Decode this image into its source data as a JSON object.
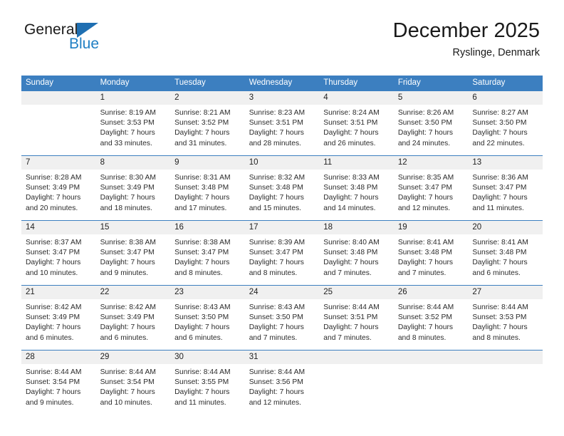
{
  "brand": {
    "name_top": "General",
    "name_bottom": "Blue",
    "triangle_color": "#1f6fb2",
    "blue_text_color": "#1f7fc4"
  },
  "header": {
    "title": "December 2025",
    "subtitle": "Ryslinge, Denmark"
  },
  "theme": {
    "header_row_bg": "#3c7fc0",
    "header_row_text": "#ffffff",
    "daynum_bg": "#f0f0f0",
    "row_separator": "#3c7fc0"
  },
  "calendar": {
    "weekday_headers": [
      "Sunday",
      "Monday",
      "Tuesday",
      "Wednesday",
      "Thursday",
      "Friday",
      "Saturday"
    ],
    "weeks": [
      [
        {
          "day": "",
          "lines": []
        },
        {
          "day": "1",
          "lines": [
            "Sunrise: 8:19 AM",
            "Sunset: 3:53 PM",
            "Daylight: 7 hours",
            "and 33 minutes."
          ]
        },
        {
          "day": "2",
          "lines": [
            "Sunrise: 8:21 AM",
            "Sunset: 3:52 PM",
            "Daylight: 7 hours",
            "and 31 minutes."
          ]
        },
        {
          "day": "3",
          "lines": [
            "Sunrise: 8:23 AM",
            "Sunset: 3:51 PM",
            "Daylight: 7 hours",
            "and 28 minutes."
          ]
        },
        {
          "day": "4",
          "lines": [
            "Sunrise: 8:24 AM",
            "Sunset: 3:51 PM",
            "Daylight: 7 hours",
            "and 26 minutes."
          ]
        },
        {
          "day": "5",
          "lines": [
            "Sunrise: 8:26 AM",
            "Sunset: 3:50 PM",
            "Daylight: 7 hours",
            "and 24 minutes."
          ]
        },
        {
          "day": "6",
          "lines": [
            "Sunrise: 8:27 AM",
            "Sunset: 3:50 PM",
            "Daylight: 7 hours",
            "and 22 minutes."
          ]
        }
      ],
      [
        {
          "day": "7",
          "lines": [
            "Sunrise: 8:28 AM",
            "Sunset: 3:49 PM",
            "Daylight: 7 hours",
            "and 20 minutes."
          ]
        },
        {
          "day": "8",
          "lines": [
            "Sunrise: 8:30 AM",
            "Sunset: 3:49 PM",
            "Daylight: 7 hours",
            "and 18 minutes."
          ]
        },
        {
          "day": "9",
          "lines": [
            "Sunrise: 8:31 AM",
            "Sunset: 3:48 PM",
            "Daylight: 7 hours",
            "and 17 minutes."
          ]
        },
        {
          "day": "10",
          "lines": [
            "Sunrise: 8:32 AM",
            "Sunset: 3:48 PM",
            "Daylight: 7 hours",
            "and 15 minutes."
          ]
        },
        {
          "day": "11",
          "lines": [
            "Sunrise: 8:33 AM",
            "Sunset: 3:48 PM",
            "Daylight: 7 hours",
            "and 14 minutes."
          ]
        },
        {
          "day": "12",
          "lines": [
            "Sunrise: 8:35 AM",
            "Sunset: 3:47 PM",
            "Daylight: 7 hours",
            "and 12 minutes."
          ]
        },
        {
          "day": "13",
          "lines": [
            "Sunrise: 8:36 AM",
            "Sunset: 3:47 PM",
            "Daylight: 7 hours",
            "and 11 minutes."
          ]
        }
      ],
      [
        {
          "day": "14",
          "lines": [
            "Sunrise: 8:37 AM",
            "Sunset: 3:47 PM",
            "Daylight: 7 hours",
            "and 10 minutes."
          ]
        },
        {
          "day": "15",
          "lines": [
            "Sunrise: 8:38 AM",
            "Sunset: 3:47 PM",
            "Daylight: 7 hours",
            "and 9 minutes."
          ]
        },
        {
          "day": "16",
          "lines": [
            "Sunrise: 8:38 AM",
            "Sunset: 3:47 PM",
            "Daylight: 7 hours",
            "and 8 minutes."
          ]
        },
        {
          "day": "17",
          "lines": [
            "Sunrise: 8:39 AM",
            "Sunset: 3:47 PM",
            "Daylight: 7 hours",
            "and 8 minutes."
          ]
        },
        {
          "day": "18",
          "lines": [
            "Sunrise: 8:40 AM",
            "Sunset: 3:48 PM",
            "Daylight: 7 hours",
            "and 7 minutes."
          ]
        },
        {
          "day": "19",
          "lines": [
            "Sunrise: 8:41 AM",
            "Sunset: 3:48 PM",
            "Daylight: 7 hours",
            "and 7 minutes."
          ]
        },
        {
          "day": "20",
          "lines": [
            "Sunrise: 8:41 AM",
            "Sunset: 3:48 PM",
            "Daylight: 7 hours",
            "and 6 minutes."
          ]
        }
      ],
      [
        {
          "day": "21",
          "lines": [
            "Sunrise: 8:42 AM",
            "Sunset: 3:49 PM",
            "Daylight: 7 hours",
            "and 6 minutes."
          ]
        },
        {
          "day": "22",
          "lines": [
            "Sunrise: 8:42 AM",
            "Sunset: 3:49 PM",
            "Daylight: 7 hours",
            "and 6 minutes."
          ]
        },
        {
          "day": "23",
          "lines": [
            "Sunrise: 8:43 AM",
            "Sunset: 3:50 PM",
            "Daylight: 7 hours",
            "and 6 minutes."
          ]
        },
        {
          "day": "24",
          "lines": [
            "Sunrise: 8:43 AM",
            "Sunset: 3:50 PM",
            "Daylight: 7 hours",
            "and 7 minutes."
          ]
        },
        {
          "day": "25",
          "lines": [
            "Sunrise: 8:44 AM",
            "Sunset: 3:51 PM",
            "Daylight: 7 hours",
            "and 7 minutes."
          ]
        },
        {
          "day": "26",
          "lines": [
            "Sunrise: 8:44 AM",
            "Sunset: 3:52 PM",
            "Daylight: 7 hours",
            "and 8 minutes."
          ]
        },
        {
          "day": "27",
          "lines": [
            "Sunrise: 8:44 AM",
            "Sunset: 3:53 PM",
            "Daylight: 7 hours",
            "and 8 minutes."
          ]
        }
      ],
      [
        {
          "day": "28",
          "lines": [
            "Sunrise: 8:44 AM",
            "Sunset: 3:54 PM",
            "Daylight: 7 hours",
            "and 9 minutes."
          ]
        },
        {
          "day": "29",
          "lines": [
            "Sunrise: 8:44 AM",
            "Sunset: 3:54 PM",
            "Daylight: 7 hours",
            "and 10 minutes."
          ]
        },
        {
          "day": "30",
          "lines": [
            "Sunrise: 8:44 AM",
            "Sunset: 3:55 PM",
            "Daylight: 7 hours",
            "and 11 minutes."
          ]
        },
        {
          "day": "31",
          "lines": [
            "Sunrise: 8:44 AM",
            "Sunset: 3:56 PM",
            "Daylight: 7 hours",
            "and 12 minutes."
          ]
        },
        {
          "day": "",
          "lines": []
        },
        {
          "day": "",
          "lines": []
        },
        {
          "day": "",
          "lines": []
        }
      ]
    ]
  }
}
